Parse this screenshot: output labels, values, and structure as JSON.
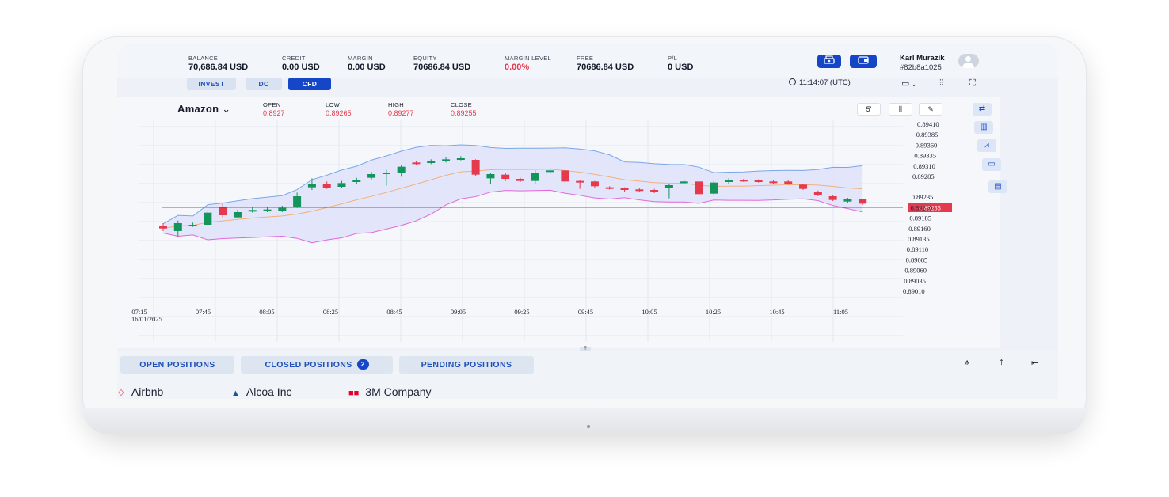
{
  "header": {
    "stats": [
      {
        "label": "BALANCE",
        "value": "70,686.84 USD",
        "color": "#121826"
      },
      {
        "label": "CREDIT",
        "value": "0.00 USD",
        "color": "#121826"
      },
      {
        "label": "MARGIN",
        "value": "0.00 USD",
        "color": "#121826"
      },
      {
        "label": "EQUITY",
        "value": "70686.84 USD",
        "color": "#121826"
      },
      {
        "label": "MARGIN LEVEL",
        "value": "0.00%",
        "color": "#e5394e"
      },
      {
        "label": "FREE",
        "value": "70686.84 USD",
        "color": "#121826"
      },
      {
        "label": "P/L",
        "value": "0 USD",
        "color": "#121826"
      }
    ],
    "buttons": [
      {
        "icon": "cash-register-icon"
      },
      {
        "icon": "wallet-icon"
      }
    ],
    "user": {
      "name": "Karl Murazik",
      "id": "#82b8a1025"
    }
  },
  "modes": {
    "items": [
      {
        "label": "INVEST",
        "active": false
      },
      {
        "label": "DC",
        "active": false
      },
      {
        "label": "CFD",
        "active": true
      }
    ],
    "clock": "11:14:07 (UTC)"
  },
  "chart_header": {
    "symbol": "Amazon",
    "ohlc": [
      {
        "label": "OPEN",
        "value": "0.8927"
      },
      {
        "label": "LOW",
        "value": "0.89265"
      },
      {
        "label": "HIGH",
        "value": "0.89277"
      },
      {
        "label": "CLOSE",
        "value": "0.89255"
      }
    ],
    "timeframe": "5'"
  },
  "chart_data": {
    "type": "candlestick",
    "x_ticks": [
      "07:15",
      "07:45",
      "08:05",
      "08:25",
      "08:45",
      "09:05",
      "09:25",
      "09:45",
      "10:05",
      "10:25",
      "10:45",
      "11:05"
    ],
    "date_label": "16/01/2025",
    "y_ticks": [
      "0.89410",
      "0.89385",
      "0.89360",
      "0.89335",
      "0.89310",
      "0.89285",
      "0.89235",
      "0.89210",
      "0.89185",
      "0.89160",
      "0.89135",
      "0.89110",
      "0.89085",
      "0.89060",
      "0.89035",
      "0.89010"
    ],
    "ylim": [
      0.89,
      0.8942
    ],
    "last_price": "0.89255",
    "up_color": "#12945a",
    "down_color": "#e5394e",
    "candles": [
      {
        "o": 0.8922,
        "c": 0.89215,
        "h": 0.89225,
        "l": 0.8921
      },
      {
        "o": 0.8921,
        "c": 0.89225,
        "h": 0.8923,
        "l": 0.892
      },
      {
        "o": 0.8922,
        "c": 0.89222,
        "h": 0.89226,
        "l": 0.89218
      },
      {
        "o": 0.89222,
        "c": 0.89245,
        "h": 0.8925,
        "l": 0.8922
      },
      {
        "o": 0.89255,
        "c": 0.8924,
        "h": 0.89262,
        "l": 0.89236
      },
      {
        "o": 0.89236,
        "c": 0.89246,
        "h": 0.8925,
        "l": 0.89234
      },
      {
        "o": 0.89249,
        "c": 0.8925,
        "h": 0.89255,
        "l": 0.89245
      },
      {
        "o": 0.8925,
        "c": 0.89251,
        "h": 0.89255,
        "l": 0.89246
      },
      {
        "o": 0.89249,
        "c": 0.89254,
        "h": 0.89258,
        "l": 0.89246
      },
      {
        "o": 0.89256,
        "c": 0.89276,
        "h": 0.89283,
        "l": 0.89254
      },
      {
        "o": 0.89293,
        "c": 0.893,
        "h": 0.8931,
        "l": 0.89288
      },
      {
        "o": 0.893,
        "c": 0.89292,
        "h": 0.89304,
        "l": 0.8929
      },
      {
        "o": 0.89294,
        "c": 0.89301,
        "h": 0.89305,
        "l": 0.89292
      },
      {
        "o": 0.89303,
        "c": 0.89307,
        "h": 0.89311,
        "l": 0.893
      },
      {
        "o": 0.89311,
        "c": 0.89318,
        "h": 0.89322,
        "l": 0.89308
      },
      {
        "o": 0.89319,
        "c": 0.89321,
        "h": 0.89326,
        "l": 0.89296
      },
      {
        "o": 0.89321,
        "c": 0.89332,
        "h": 0.89336,
        "l": 0.89313
      },
      {
        "o": 0.8934,
        "c": 0.89338,
        "h": 0.89342,
        "l": 0.89336
      },
      {
        "o": 0.89339,
        "c": 0.89342,
        "h": 0.89346,
        "l": 0.89337
      },
      {
        "o": 0.89342,
        "c": 0.89346,
        "h": 0.8935,
        "l": 0.8934
      },
      {
        "o": 0.89346,
        "c": 0.89348,
        "h": 0.89352,
        "l": 0.89344
      },
      {
        "o": 0.89345,
        "c": 0.89317,
        "h": 0.89346,
        "l": 0.89315
      },
      {
        "o": 0.8931,
        "c": 0.89318,
        "h": 0.89321,
        "l": 0.893
      },
      {
        "o": 0.89317,
        "c": 0.89309,
        "h": 0.8932,
        "l": 0.89305
      },
      {
        "o": 0.89309,
        "c": 0.89305,
        "h": 0.89311,
        "l": 0.89303
      },
      {
        "o": 0.89305,
        "c": 0.89321,
        "h": 0.89325,
        "l": 0.893
      },
      {
        "o": 0.89322,
        "c": 0.89325,
        "h": 0.8933,
        "l": 0.89318
      },
      {
        "o": 0.89325,
        "c": 0.89304,
        "h": 0.89327,
        "l": 0.89302
      },
      {
        "o": 0.89305,
        "c": 0.89304,
        "h": 0.89307,
        "l": 0.8929
      },
      {
        "o": 0.89304,
        "c": 0.89295,
        "h": 0.89305,
        "l": 0.89292
      },
      {
        "o": 0.89293,
        "c": 0.89292,
        "h": 0.89295,
        "l": 0.89289
      },
      {
        "o": 0.89291,
        "c": 0.8929,
        "h": 0.89293,
        "l": 0.89285
      },
      {
        "o": 0.89289,
        "c": 0.89288,
        "h": 0.89291,
        "l": 0.89285
      },
      {
        "o": 0.89288,
        "c": 0.89287,
        "h": 0.8929,
        "l": 0.89282
      },
      {
        "o": 0.89292,
        "c": 0.89297,
        "h": 0.893,
        "l": 0.89272
      },
      {
        "o": 0.89301,
        "c": 0.89304,
        "h": 0.89307,
        "l": 0.89299
      },
      {
        "o": 0.89304,
        "c": 0.8928,
        "h": 0.89305,
        "l": 0.89271
      },
      {
        "o": 0.89281,
        "c": 0.89302,
        "h": 0.89305,
        "l": 0.89279
      },
      {
        "o": 0.89303,
        "c": 0.89307,
        "h": 0.8931,
        "l": 0.893
      },
      {
        "o": 0.89307,
        "c": 0.89305,
        "h": 0.89309,
        "l": 0.89303
      },
      {
        "o": 0.89306,
        "c": 0.89304,
        "h": 0.89308,
        "l": 0.89302
      },
      {
        "o": 0.89304,
        "c": 0.89302,
        "h": 0.89306,
        "l": 0.893
      },
      {
        "o": 0.89304,
        "c": 0.893,
        "h": 0.89306,
        "l": 0.89298
      },
      {
        "o": 0.89298,
        "c": 0.8929,
        "h": 0.893,
        "l": 0.89288
      },
      {
        "o": 0.89285,
        "c": 0.89279,
        "h": 0.89287,
        "l": 0.89276
      },
      {
        "o": 0.89276,
        "c": 0.89269,
        "h": 0.89278,
        "l": 0.89267
      },
      {
        "o": 0.89266,
        "c": 0.89271,
        "h": 0.89273,
        "l": 0.89264
      },
      {
        "o": 0.8927,
        "c": 0.89262,
        "h": 0.89271,
        "l": 0.8926
      }
    ]
  },
  "chart_controls": [
    {
      "icon": "chevron-left-icon",
      "glyph": "‹"
    },
    {
      "icon": "zoom-in-icon",
      "glyph": "⊕"
    },
    {
      "icon": "zoom-out-icon",
      "glyph": "⊖"
    },
    {
      "icon": "zoom-in-reset-icon",
      "glyph": "⊕"
    },
    {
      "icon": "zoom-out-reset-icon",
      "glyph": "⊖"
    },
    {
      "icon": "chevron-right-icon",
      "glyph": "›"
    }
  ],
  "positions": {
    "tabs": [
      {
        "label": "OPEN POSITIONS"
      },
      {
        "label": "CLOSED POSITIONS",
        "badge": "2"
      },
      {
        "label": "PENDING POSITIONS"
      }
    ],
    "assets": [
      {
        "name": "Airbnb",
        "color": "#ff5a5f"
      },
      {
        "name": "Alcoa Inc",
        "color": "#1c4f9c"
      },
      {
        "name": "3M Company",
        "color": "#e4002b"
      }
    ]
  }
}
